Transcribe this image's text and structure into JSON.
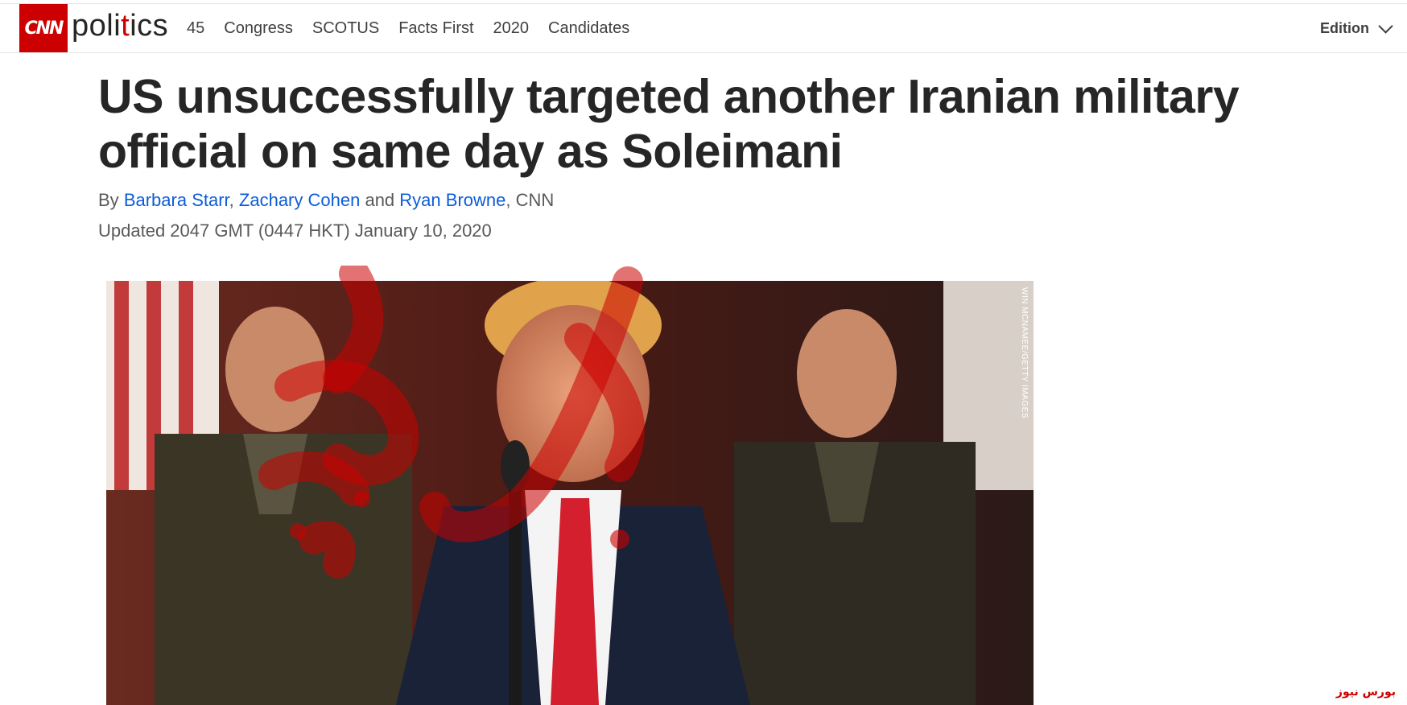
{
  "header": {
    "logo_text": "CNN",
    "section_name_part1": "poli",
    "section_name_accent": "t",
    "section_name_part2": "ics",
    "nav_items": [
      "45",
      "Congress",
      "SCOTUS",
      "Facts First",
      "2020",
      "Candidates"
    ],
    "edition_label": "Edition"
  },
  "article": {
    "headline": "US unsuccessfully targeted another Iranian military official on same day as Soleimani",
    "byline_prefix": "By",
    "authors": [
      "Barbara Starr",
      "Zachary Cohen",
      "Ryan Browne"
    ],
    "byline_sep1": ",",
    "byline_and": "and",
    "byline_suffix": ", CNN",
    "updated": "Updated 2047 GMT (0447 HKT) January 10, 2020",
    "photo_credit": "WIN MCNAMEE/GETTY IMAGES"
  },
  "watermark": {
    "text": "بورس نیوز",
    "color": "#cc0000"
  },
  "colors": {
    "brand": "#cc0000",
    "link": "#0c5dd8",
    "text": "#262626",
    "muted": "#595959"
  }
}
